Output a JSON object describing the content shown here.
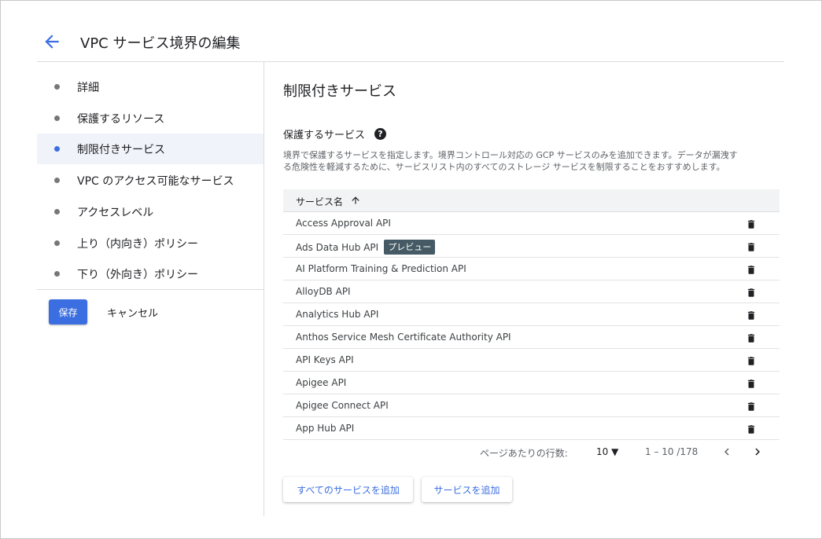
{
  "header": {
    "back_icon": "arrow-back-icon",
    "title": "VPC サービス境界の編集"
  },
  "sidebar": {
    "steps": [
      {
        "label": "詳細",
        "active": false
      },
      {
        "label": "保護するリソース",
        "active": false
      },
      {
        "label": "制限付きサービス",
        "active": true
      },
      {
        "label": "VPC のアクセス可能なサービス",
        "active": false
      },
      {
        "label": "アクセスレベル",
        "active": false
      },
      {
        "label": "上り（内向き）ポリシー",
        "active": false
      },
      {
        "label": "下り（外向き）ポリシー",
        "active": false
      }
    ],
    "save_label": "保存",
    "cancel_label": "キャンセル"
  },
  "main": {
    "section_title": "制限付きサービス",
    "sub_title": "保護するサービス",
    "help_icon": "help-icon",
    "description_line1": "境界で保護するサービスを指定します。境界コントロール対応の GCP サービスのみを追加できます。データが漏洩す",
    "description_line2": "る危険性を軽減するために、サービスリスト内のすべてのストレージ サービスを制限することをおすすめします。",
    "table": {
      "column_header": "サービス名",
      "sort_icon": "arrow-upward-icon",
      "delete_icon": "trash-icon",
      "rows": [
        {
          "name": "Access Approval API",
          "badge": ""
        },
        {
          "name": "Ads Data Hub API",
          "badge": "プレビュー"
        },
        {
          "name": "AI Platform Training & Prediction API",
          "badge": ""
        },
        {
          "name": "AlloyDB API",
          "badge": ""
        },
        {
          "name": "Analytics Hub API",
          "badge": ""
        },
        {
          "name": "Anthos Service Mesh Certificate Authority API",
          "badge": ""
        },
        {
          "name": "API Keys API",
          "badge": ""
        },
        {
          "name": "Apigee API",
          "badge": ""
        },
        {
          "name": "Apigee Connect API",
          "badge": ""
        },
        {
          "name": "App Hub API",
          "badge": ""
        }
      ]
    },
    "pagination": {
      "rows_per_page_label": "ページあたりの行数:",
      "rows_per_page_value": "10",
      "range": "1 – 10 /178",
      "prev_icon": "chevron-left-icon",
      "next_icon": "chevron-right-icon"
    },
    "add_all_label": "すべてのサービスを追加",
    "add_label": "サービスを追加"
  },
  "colors": {
    "accent": "#3b6ee0",
    "badge_bg": "#455a64",
    "active_step_bg": "#f1f3fa",
    "table_header_bg": "#f1f3f4"
  }
}
